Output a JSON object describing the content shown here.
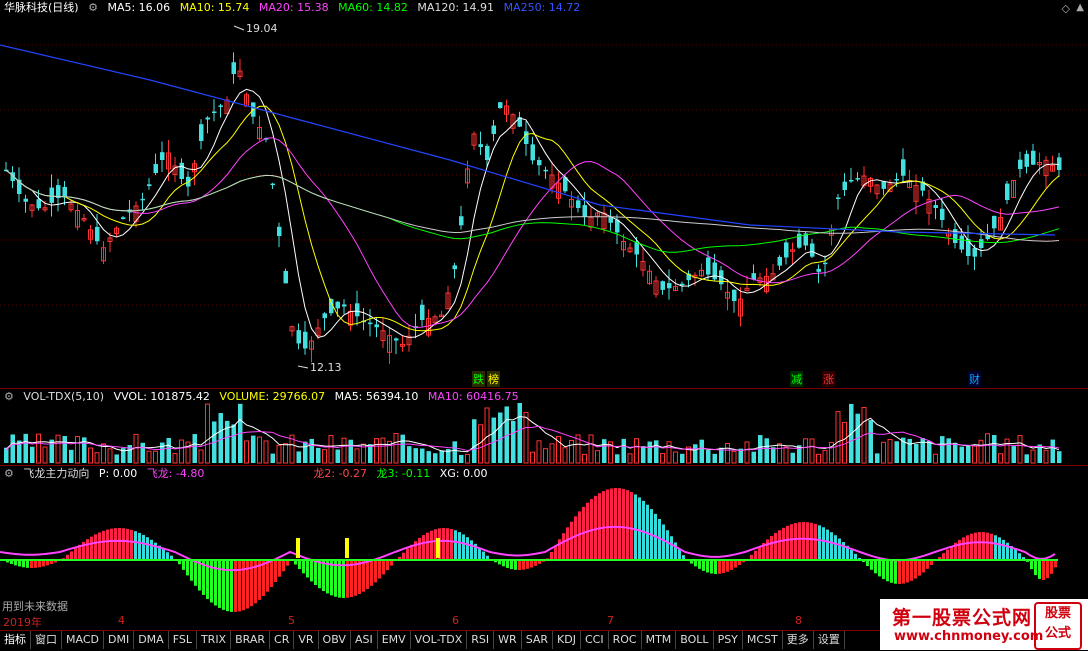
{
  "main": {
    "title": "华脉科技(日线)",
    "ma5": "MA5: 16.06",
    "ma10": "MA10: 15.74",
    "ma20": "MA20: 15.38",
    "ma60": "MA60: 14.82",
    "ma120": "MA120: 14.91",
    "ma250": "MA250: 14.72",
    "high_label": "19.04",
    "low_label": "12.13",
    "signals": [
      {
        "text": "跌",
        "color": "#00ff00",
        "bg": "#3a3a00"
      },
      {
        "text": "榜",
        "color": "#ffff00",
        "bg": "#3a3a00"
      },
      {
        "text": "减",
        "color": "#00ff00",
        "bg": "#003a00"
      },
      {
        "text": "涨",
        "color": "#ff3333",
        "bg": "#3a0000"
      },
      {
        "text": "财",
        "color": "#00aaff",
        "bg": "#00003a"
      }
    ]
  },
  "vol": {
    "title": "VOL-TDX(5,10)",
    "vvol": "VVOL: 101875.42",
    "volume": "VOLUME: 29766.07",
    "ma5": "MA5: 56394.10",
    "ma10": "MA10: 60416.75"
  },
  "ind": {
    "title": "飞龙主力动向",
    "p": "P: 0.00",
    "feilong": "飞龙: -4.80",
    "long2": "龙2: -0.27",
    "long3": "龙3: -0.11",
    "xg": "XG: 0.00",
    "note": "用到未来数据"
  },
  "dates": {
    "year": "2019年",
    "m4": "4",
    "m5": "5",
    "m6": "6",
    "m7": "7",
    "m8": "8"
  },
  "tabs": [
    "指标",
    "窗口",
    "MACD",
    "DMI",
    "DMA",
    "FSL",
    "TRIX",
    "BRAR",
    "CR",
    "VR",
    "OBV",
    "ASI",
    "EMV",
    "VOL-TDX",
    "RSI",
    "WR",
    "SAR",
    "KDJ",
    "CCI",
    "ROC",
    "MTM",
    "BOLL",
    "PSY",
    "MCST",
    "更多",
    "设置"
  ],
  "watermark": {
    "line1": "第一股票公式网",
    "line2": "www.chnmoney.com",
    "logo1": "股票",
    "logo2": "公式"
  }
}
